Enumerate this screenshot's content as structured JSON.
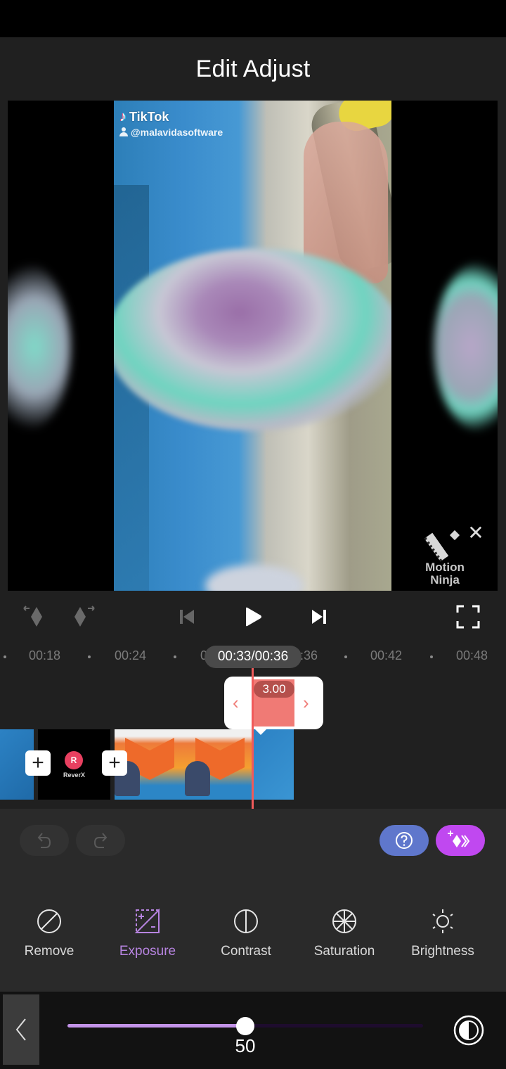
{
  "header": {
    "title": "Edit Adjust"
  },
  "preview": {
    "tiktok_brand": "TikTok",
    "tiktok_user": "@malavidasoftware",
    "watermark_line1": "Motion",
    "watermark_line2": "Ninja",
    "watermark_close": "✕"
  },
  "playback": {
    "current_time": "00:33",
    "total_time": "00:36",
    "time_display": "00:33/00:36"
  },
  "ruler": {
    "ticks": [
      "00:18",
      "00:24",
      "00:30",
      "00:36",
      "00:42",
      "00:48"
    ]
  },
  "timeline": {
    "clips": [
      {
        "name": "blue-clip"
      },
      {
        "name": "reverse-clip",
        "logo": "R",
        "text": "ReverX"
      },
      {
        "name": "shield-clip-1"
      },
      {
        "name": "shield-clip-2"
      },
      {
        "name": "blue-clip-2"
      }
    ],
    "add_label": "+",
    "selected_duration": "3.00",
    "trim_left": "‹",
    "trim_right": "›"
  },
  "actions": {
    "undo": "undo-icon",
    "redo": "redo-icon",
    "help": "help-icon",
    "ai_transition": "ai-transition-icon"
  },
  "tools": [
    {
      "id": "remove",
      "label": "Remove",
      "active": false
    },
    {
      "id": "exposure",
      "label": "Exposure",
      "active": true
    },
    {
      "id": "contrast",
      "label": "Contrast",
      "active": false
    },
    {
      "id": "saturation",
      "label": "Saturation",
      "active": false
    },
    {
      "id": "brightness",
      "label": "Brightness",
      "active": false
    }
  ],
  "slider": {
    "value": 50,
    "value_label": "50",
    "min": 0,
    "max": 100
  },
  "colors": {
    "accent": "#b784e0",
    "playhead": "#f05a5a",
    "trim": "#f07a75",
    "help_button": "#5f77cc",
    "ai_button": "#c048f0"
  }
}
